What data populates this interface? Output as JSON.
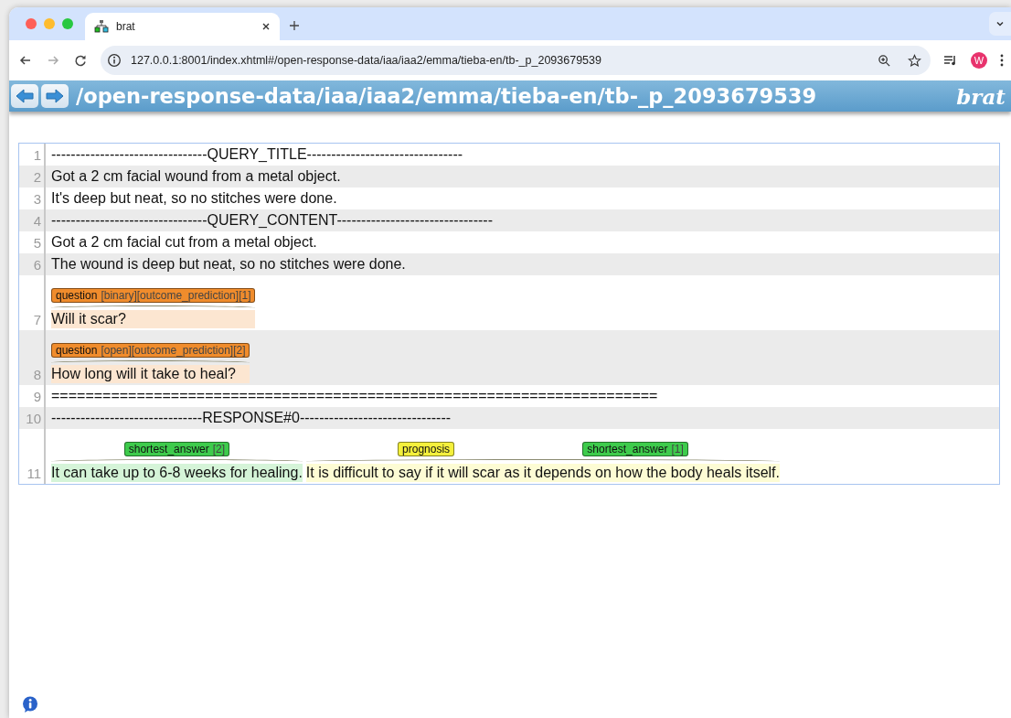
{
  "browser": {
    "tab": {
      "title": "brat",
      "selected": true
    },
    "url": "127.0.0.1:8001/index.xhtml#/open-response-data/iaa/iaa2/emma/tieba-en/tb-_p_2093679539",
    "avatar": "W"
  },
  "header": {
    "path": "/open-response-data/iaa/iaa2/emma/tieba-en/tb-_p_2093679539",
    "logo": "brat"
  },
  "lines": [
    {
      "number": "1",
      "segments": [
        {
          "kind": "plain",
          "text": "--------------------------------QUERY_TITLE--------------------------------"
        }
      ]
    },
    {
      "number": "2",
      "segments": [
        {
          "kind": "plain",
          "text": "Got a 2 cm facial wound from a metal object."
        }
      ]
    },
    {
      "number": "3",
      "segments": [
        {
          "kind": "plain",
          "text": "It's deep but neat, so no stitches were done."
        }
      ]
    },
    {
      "number": "4",
      "segments": [
        {
          "kind": "plain",
          "text": "--------------------------------QUERY_CONTENT--------------------------------"
        }
      ]
    },
    {
      "number": "5",
      "segments": [
        {
          "kind": "plain",
          "text": "Got a 2 cm facial cut from a metal object."
        }
      ]
    },
    {
      "number": "6",
      "segments": [
        {
          "kind": "plain",
          "text": "The wound is deep but neat, so no stitches were done."
        }
      ]
    },
    {
      "number": "7",
      "segments": [
        {
          "kind": "span",
          "text": "Will it scar?",
          "labels": [
            {
              "type": "question",
              "attributes": "[binary][outcome_prediction][1]",
              "color": "#f08c2c"
            }
          ]
        }
      ]
    },
    {
      "number": "8",
      "segments": [
        {
          "kind": "span",
          "text": "How long will it take to heal?",
          "labels": [
            {
              "type": "question",
              "attributes": "[open][outcome_prediction][2]",
              "color": "#f08c2c"
            }
          ]
        }
      ]
    },
    {
      "number": "9",
      "segments": [
        {
          "kind": "plain",
          "text": "======================================================================="
        }
      ]
    },
    {
      "number": "10",
      "segments": [
        {
          "kind": "plain",
          "text": "-------------------------------RESPONSE#0-------------------------------"
        }
      ]
    },
    {
      "number": "11",
      "segments": [
        {
          "kind": "span",
          "text": "It can take up to 6-8 weeks for healing.",
          "labels": [
            {
              "type": "shortest_answer",
              "attributes": "[2]",
              "color": "#3ecb4c"
            }
          ]
        },
        {
          "kind": "span",
          "text": "It is difficult to say if it will scar as it depends on how the body heals itself.",
          "labels": [
            {
              "type": "prognosis",
              "color": "#f4f03c"
            },
            {
              "type": "shortest_answer",
              "attributes": "[1]",
              "color": "#3ecb4c"
            }
          ]
        }
      ]
    }
  ]
}
